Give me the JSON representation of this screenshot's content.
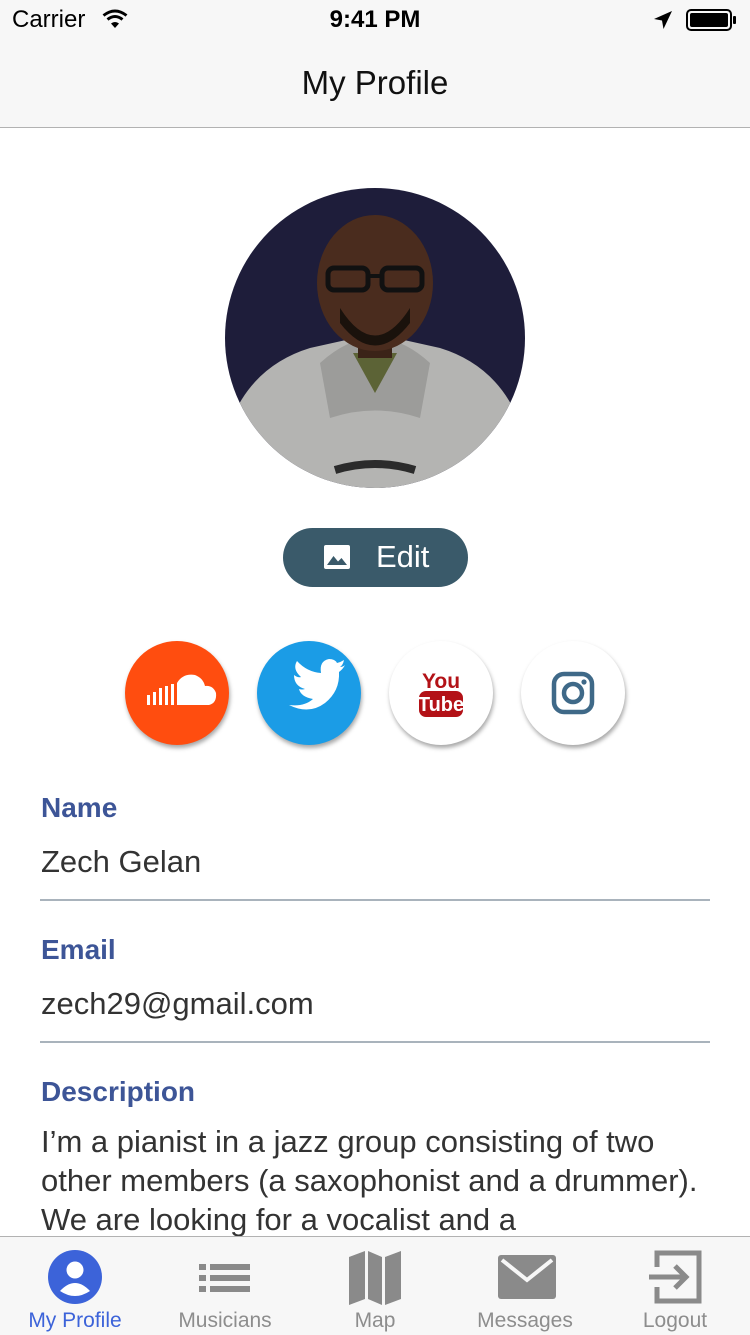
{
  "status_bar": {
    "carrier": "Carrier",
    "time": "9:41 PM"
  },
  "nav": {
    "title": "My Profile"
  },
  "profile": {
    "edit_label": "Edit",
    "avatar_icon": "profile-photo"
  },
  "social": [
    {
      "name": "SoundCloud",
      "icon": "soundcloud-icon",
      "color": "#ff4d0f"
    },
    {
      "name": "Twitter",
      "icon": "twitter-icon",
      "color": "#1b9ce6"
    },
    {
      "name": "YouTube",
      "icon": "youtube-icon",
      "color": "#ffffff",
      "logo_top": "You",
      "logo_bottom": "Tube"
    },
    {
      "name": "Instagram",
      "icon": "instagram-icon",
      "color": "#ffffff"
    }
  ],
  "fields": {
    "name": {
      "label": "Name",
      "value": "Zech Gelan"
    },
    "email": {
      "label": "Email",
      "value": "zech29@gmail.com"
    },
    "description": {
      "label": "Description",
      "value": "I’m a pianist in a jazz group consisting of two other members (a saxophonist and a drummer). We are looking for a vocalist and a"
    }
  },
  "tabs": [
    {
      "label": "My Profile",
      "icon": "person-icon",
      "active": true
    },
    {
      "label": "Musicians",
      "icon": "list-icon",
      "active": false
    },
    {
      "label": "Map",
      "icon": "map-icon",
      "active": false
    },
    {
      "label": "Messages",
      "icon": "envelope-icon",
      "active": false
    },
    {
      "label": "Logout",
      "icon": "logout-icon",
      "active": false
    }
  ],
  "colors": {
    "accent": "#3c63d9",
    "label": "#3d5597",
    "edit_button": "#3a5a6a",
    "tab_inactive": "#8d8d8d"
  }
}
